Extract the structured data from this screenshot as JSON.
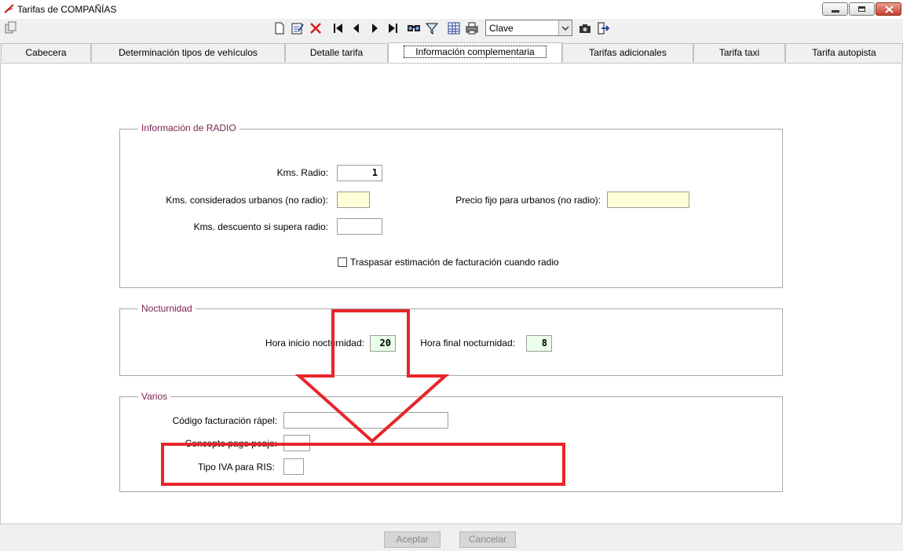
{
  "window": {
    "title": "Tarifas de COMPAÑÍAS"
  },
  "toolbar": {
    "icons": [
      "copy-icon",
      "new-icon",
      "edit-icon",
      "delete-icon",
      "first-icon",
      "prev-icon",
      "next-icon",
      "last-icon",
      "search-icon",
      "filter-icon",
      "grid-icon",
      "print-icon",
      "camera-icon",
      "exit-icon"
    ],
    "combo_value": "Clave"
  },
  "tabs": [
    {
      "label": "Cabecera"
    },
    {
      "label": "Determinación tipos de vehículos"
    },
    {
      "label": "Detalle tarifa"
    },
    {
      "label": "Información complementaria"
    },
    {
      "label": "Tarifas adicionales"
    },
    {
      "label": "Tarifa taxi"
    },
    {
      "label": "Tarifa autopista"
    }
  ],
  "radio": {
    "legend": "Información de RADIO",
    "kms_radio_label": "Kms. Radio:",
    "kms_radio_value": "1",
    "kms_urbanos_label": "Kms. considerados urbanos (no radio):",
    "kms_urbanos_value": "",
    "precio_fijo_label": "Precio fijo para urbanos (no radio):",
    "precio_fijo_value": "",
    "kms_descuento_label": "Kms. descuento si supera radio:",
    "kms_descuento_value": "",
    "traspasar_label": "Traspasar estimación de facturación cuando radio",
    "traspasar_checked": false
  },
  "nocturnidad": {
    "legend": "Nocturnidad",
    "hora_inicio_label": "Hora inicio nocturnidad:",
    "hora_inicio_value": "20",
    "hora_final_label": "Hora final nocturnidad:",
    "hora_final_value": "8"
  },
  "varios": {
    "legend": "Varios",
    "codigo_label": "Código facturación rápel:",
    "codigo_value": "",
    "concepto_label": "Concepto pago peaje:",
    "concepto_value": "",
    "tipo_iva_label": "Tipo IVA para RIS:",
    "tipo_iva_value": ""
  },
  "buttons": {
    "accept": "Aceptar",
    "cancel": "Cancelar"
  },
  "colors": {
    "annotation": "#e8252b",
    "legend": "#7a1f4f",
    "input_yellow": "#ffffd8",
    "input_green": "#eaffea"
  }
}
